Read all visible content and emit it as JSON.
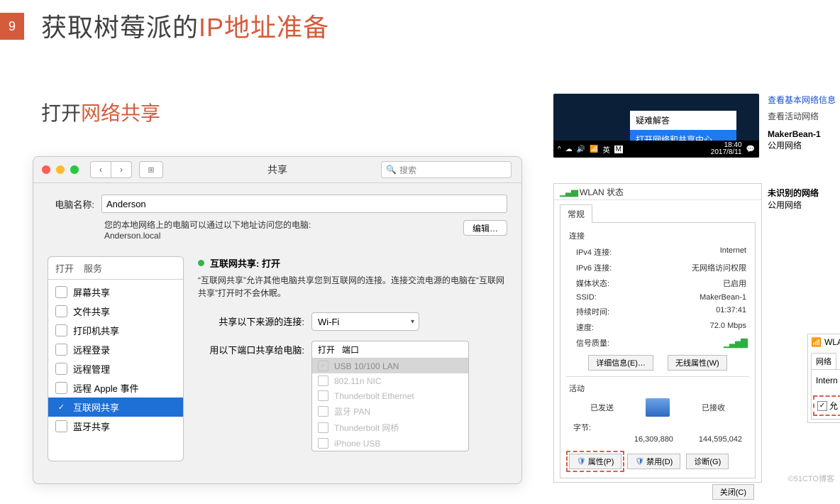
{
  "slide": {
    "number": "9",
    "title_pre": "获取树莓派的",
    "title_accent": "IP地址准备",
    "sub_pre": "打开",
    "sub_accent": "网络共享"
  },
  "mac": {
    "title": "共享",
    "search_placeholder": "搜索",
    "search_icon": "🔍",
    "name_label": "电脑名称:",
    "name_value": "Anderson",
    "help_line": "您的本地网络上的电脑可以通过以下地址访问您的电脑:",
    "help_host": "Anderson.local",
    "edit": "编辑…",
    "sidebar": {
      "col_open": "打开",
      "col_service": "服务",
      "items": [
        {
          "checked": false,
          "label": "屏幕共享"
        },
        {
          "checked": false,
          "label": "文件共享"
        },
        {
          "checked": false,
          "label": "打印机共享"
        },
        {
          "checked": false,
          "label": "远程登录"
        },
        {
          "checked": false,
          "label": "远程管理"
        },
        {
          "checked": false,
          "label": "远程 Apple 事件"
        },
        {
          "checked": true,
          "label": "互联网共享",
          "selected": true
        },
        {
          "checked": false,
          "label": "蓝牙共享"
        }
      ]
    },
    "status_title": "互联网共享: 打开",
    "desc": "“互联网共享”允许其他电脑共享您到互联网的连接。连接交流电源的电脑在“互联网共享”打开时不会休眠。",
    "src_label": "共享以下来源的连接:",
    "src_value": "Wi-Fi",
    "ports_label": "用以下端口共享给电脑:",
    "ports_head_open": "打开",
    "ports_head_port": "端口",
    "ports": [
      {
        "checked": true,
        "label": "USB 10/100 LAN",
        "selected": true
      },
      {
        "checked": false,
        "label": "802.11n NIC"
      },
      {
        "checked": false,
        "label": "Thunderbolt Ethernet"
      },
      {
        "checked": false,
        "label": "蓝牙 PAN"
      },
      {
        "checked": false,
        "label": "Thunderbolt 网桥"
      },
      {
        "checked": false,
        "label": "iPhone USB"
      }
    ]
  },
  "tray": {
    "menu_item1": "疑难解答",
    "menu_item2": "打开网络和共享中心",
    "time": "18:40",
    "date": "2017/8/11",
    "lang": "英",
    "m": "M"
  },
  "netinfo": {
    "link": "查看基本网络信息",
    "sec": "查看活动网络",
    "name": "MakerBean-1",
    "type": "公用网络",
    "unident": "未识别的网络",
    "type2": "公用网络"
  },
  "wlan": {
    "title": "WLAN 状态",
    "tab": "常规",
    "section_conn": "连接",
    "rows": [
      {
        "k": "IPv4 连接:",
        "v": "Internet"
      },
      {
        "k": "IPv6 连接:",
        "v": "无网络访问权限"
      },
      {
        "k": "媒体状态:",
        "v": "已启用"
      },
      {
        "k": "SSID:",
        "v": "MakerBean-1"
      },
      {
        "k": "持续时间:",
        "v": "01:37:41"
      },
      {
        "k": "速度:",
        "v": "72.0 Mbps"
      }
    ],
    "signal_label": "信号质量:",
    "btn_detail": "详细信息(E)…",
    "btn_wireless": "无线属性(W)",
    "section_act": "活动",
    "sent": "已发送",
    "recv": "已接收",
    "bytes_label": "字节:",
    "bytes_sent": "16,309,880",
    "bytes_recv": "144,595,042",
    "btn_prop": "属性(P)",
    "btn_disable": "禁用(D)",
    "btn_diag": "诊断(G)",
    "btn_close": "关闭(C)"
  },
  "wlan2": {
    "hdr": "WLAN",
    "tab": "网络",
    "row": "Intern",
    "chk": "允"
  },
  "watermark": "©51CTO博客"
}
